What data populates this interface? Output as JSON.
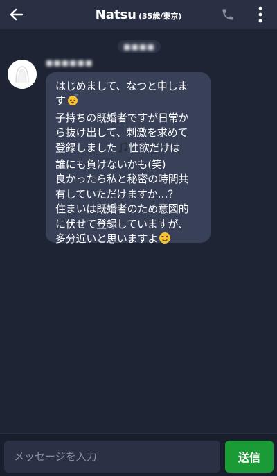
{
  "header": {
    "name": "Natsu",
    "info": "(35歳/東京)",
    "back_icon": "arrow-left-icon",
    "call_icon": "phone-icon",
    "menu_icon": "more-vertical-icon"
  },
  "chat": {
    "date_label": "■■■■",
    "message": {
      "sender_name": "■■■■■■",
      "lines": [
        "はじめまして、なつと申しま",
        "す",
        "子持ちの既婚者ですが日常か",
        "ら抜け出して、刺激を求めて",
        "登録しました",
        "誰にも負けないかも(笑)",
        "良かったら私と秘密の時間共",
        "有していただけますか…？",
        "住まいは既婚者のため意図的",
        "に伏せて登録していますが、",
        "多分近いと思いますよ"
      ],
      "line5_suffix": "性欲だけは",
      "emojis": [
        "sleeping-face-icon",
        "music-notes-icon",
        "winking-face-icon"
      ]
    }
  },
  "composer": {
    "placeholder": "メッセージを入力",
    "send_label": "送信"
  },
  "colors": {
    "background": "#1e2434",
    "header": "#2a3044",
    "bubble": "#394159",
    "send_button": "#1a9b35"
  }
}
